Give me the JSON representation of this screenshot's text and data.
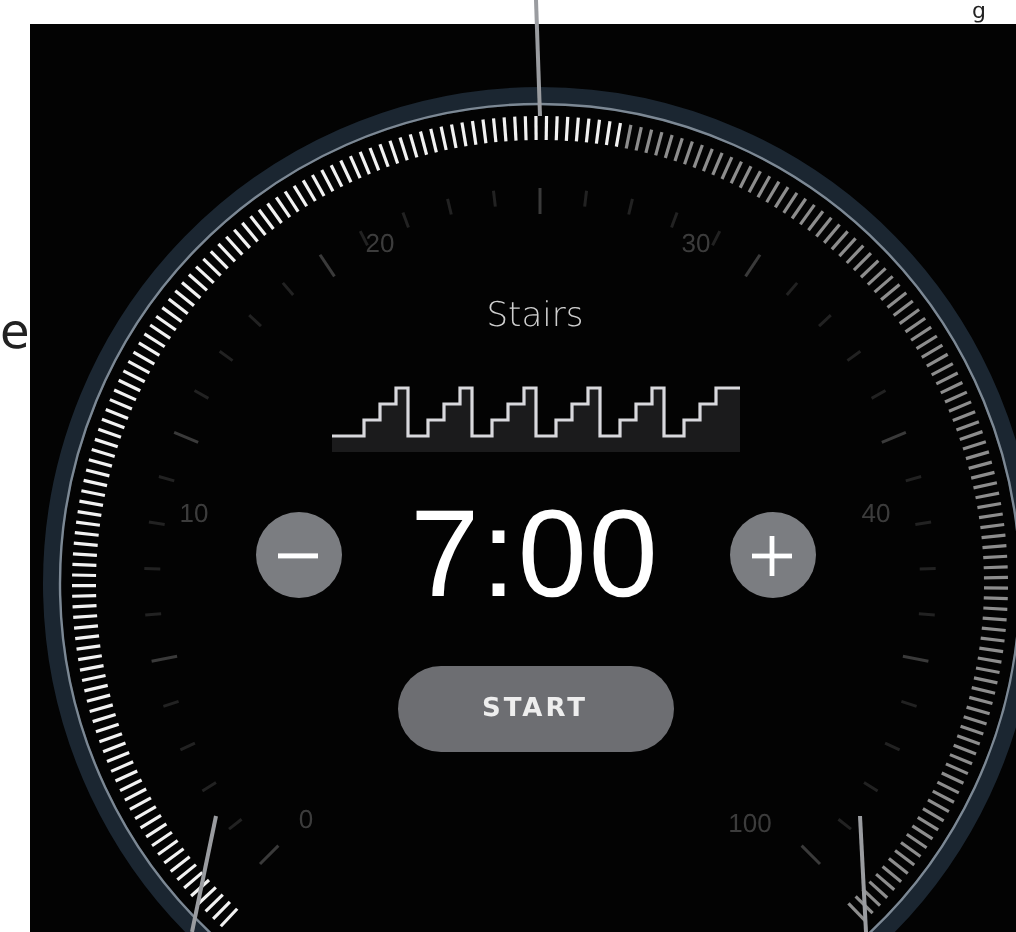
{
  "annotations": [
    {
      "text": "g"
    },
    {
      "text": "e"
    }
  ],
  "dial": {
    "scale_labels": [
      "0",
      "10",
      "20",
      "30",
      "40",
      "100"
    ]
  },
  "workout": {
    "title": "Stairs",
    "time": "7:00",
    "start_button": "START"
  }
}
